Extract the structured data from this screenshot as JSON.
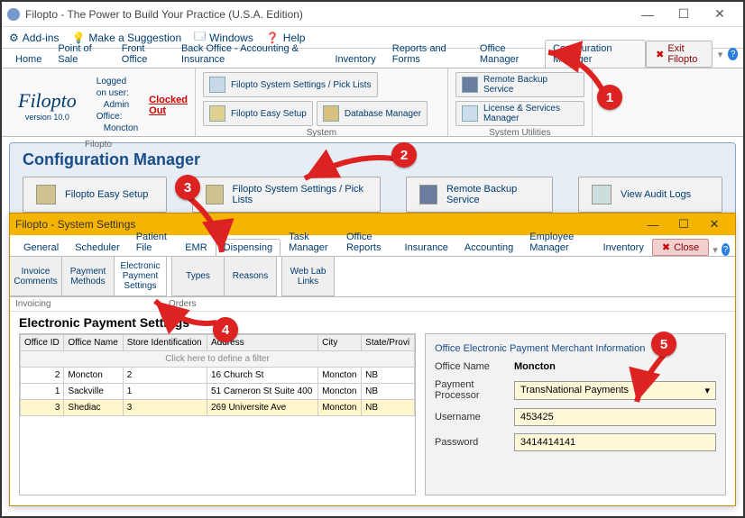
{
  "window": {
    "title": "Filopto - The Power to Build Your Practice (U.S.A. Edition)"
  },
  "menubar": {
    "addins": "Add-ins",
    "suggest": "Make a Suggestion",
    "windows": "Windows",
    "help": "Help"
  },
  "tabs": {
    "home": "Home",
    "pos": "Point of Sale",
    "front": "Front Office",
    "back": "Back Office - Accounting & Insurance",
    "inventory": "Inventory",
    "reports": "Reports and Forms",
    "office_mgr": "Office Manager",
    "config_mgr": "Configuration Manager",
    "exit": "Exit Filopto"
  },
  "logon": {
    "label_user": "Logged on user:",
    "user": "Admin",
    "label_office": "Office:",
    "office": "Moncton",
    "clocked": "Clocked Out"
  },
  "logo": {
    "name": "Filopto",
    "version": "version 10.0"
  },
  "ribbon": {
    "group1": "Filopto",
    "group2": "System",
    "group3": "System Utilities",
    "btn_settings": "Filopto System Settings / Pick Lists",
    "btn_db": "Database Manager",
    "btn_easy": "Filopto Easy Setup",
    "btn_backup": "Remote Backup Service",
    "btn_license": "License & Services Manager"
  },
  "panel": {
    "title": "Configuration Manager",
    "easy": "Filopto Easy Setup",
    "settings": "Filopto System Settings / Pick Lists",
    "backup": "Remote Backup Service",
    "audit": "View Audit Logs"
  },
  "child": {
    "title": "Filopto - System Settings",
    "tabs": {
      "general": "General",
      "scheduler": "Scheduler",
      "patient": "Patient File",
      "emr": "EMR",
      "dispensing": "Dispensing",
      "task": "Task Manager",
      "reports": "Office Reports",
      "insurance": "Insurance",
      "accounting": "Accounting",
      "emp": "Employee Manager",
      "inventory": "Inventory"
    },
    "close": "Close",
    "subribbon": {
      "invoice": "Invoice Comments",
      "pmethods": "Payment Methods",
      "eps": "Electronic Payment Settings",
      "types": "Types",
      "reasons": "Reasons",
      "weblab": "Web Lab Links"
    },
    "sublabel1": "Invoicing",
    "sublabel2": "Orders",
    "section": "Electronic Payment Settings",
    "grid": {
      "cols": {
        "id": "Office ID",
        "name": "Office Name",
        "store": "Store Identification",
        "addr": "Address",
        "city": "City",
        "state": "State/Provi"
      },
      "filter_hint": "Click here to define a filter",
      "rows": [
        {
          "id": "2",
          "name": "Moncton",
          "store": "2",
          "addr": "16 Church St",
          "city": "Moncton",
          "state": "NB"
        },
        {
          "id": "1",
          "name": "Sackville",
          "store": "1",
          "addr": "51 Cameron St Suite 400",
          "city": "Moncton",
          "state": "NB"
        },
        {
          "id": "3",
          "name": "Shediac",
          "store": "3",
          "addr": "269 Universite Ave",
          "city": "Moncton",
          "state": "NB"
        }
      ]
    },
    "detail": {
      "legend": "Office Electronic Payment Merchant Information",
      "lbl_office": "Office Name",
      "office": "Moncton",
      "lbl_proc": "Payment Processor",
      "processor": "TransNational Payments",
      "lbl_user": "Username",
      "username": "453425",
      "lbl_pass": "Password",
      "password": "3414414141"
    }
  },
  "callouts": {
    "c1": "1",
    "c2": "2",
    "c3": "3",
    "c4": "4",
    "c5": "5"
  }
}
